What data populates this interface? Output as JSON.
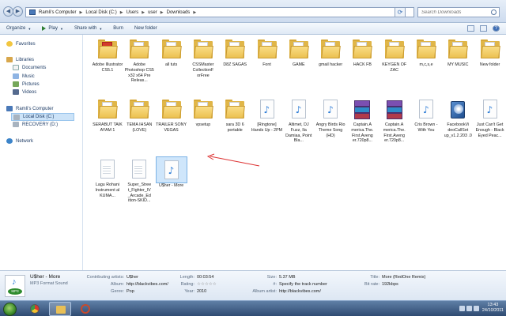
{
  "address": {
    "breadcrumbs": [
      "Ramli's Computer",
      "Local Disk (C:)",
      "Users",
      "user",
      "Downloads"
    ],
    "search_placeholder": "Search Downloads"
  },
  "toolbar": {
    "organize": "Organize",
    "play": "Play",
    "share": "Share with",
    "burn": "Burn",
    "new_folder": "New folder"
  },
  "sidebar": {
    "favorites": "Favorites",
    "libraries": "Libraries",
    "documents": "Documents",
    "music": "Music",
    "pictures": "Pictures",
    "videos": "Videos",
    "computer": "Ramli's Computer",
    "local_disk": "Local Disk (C:)",
    "recovery": "RECOVERY (D:)",
    "network": "Network"
  },
  "files": [
    {
      "label": "Adobe Illustrator CS5.1",
      "kind": "folder-red"
    },
    {
      "label": "Adobe Photoshop CS5 x32 x64 Pre Releas...",
      "kind": "folder"
    },
    {
      "label": "all tuts",
      "kind": "folder"
    },
    {
      "label": "CSSMaster CollectionF orFree",
      "kind": "folder"
    },
    {
      "label": "D8Z SAGAS",
      "kind": "folder"
    },
    {
      "label": "Font",
      "kind": "folder"
    },
    {
      "label": "GAME",
      "kind": "folder"
    },
    {
      "label": "gmail hacker",
      "kind": "folder"
    },
    {
      "label": "HACK FB",
      "kind": "folder"
    },
    {
      "label": "KEYGEN OF ZAC",
      "kind": "folder"
    },
    {
      "label": "m,c,s,e",
      "kind": "folder"
    },
    {
      "label": "MY MUSIC",
      "kind": "folder"
    },
    {
      "label": "New folder",
      "kind": "folder"
    },
    {
      "label": "SERABUT TAIK AYAM 1",
      "kind": "folder"
    },
    {
      "label": "TEMA IHSAN (LOVE)",
      "kind": "folder"
    },
    {
      "label": "TRAILER SONY VEGAS",
      "kind": "folder"
    },
    {
      "label": "vpsetup",
      "kind": "folder"
    },
    {
      "label": "sara 3D 6 portable",
      "kind": "folder"
    },
    {
      "label": "[Ringtone] Hands Up - 2PM",
      "kind": "audio"
    },
    {
      "label": "Altimet, DJ Fuzz, Ila Damiaa, Point Bla...",
      "kind": "audio"
    },
    {
      "label": "Angry Birds Rio Theme Song (HD)",
      "kind": "audio"
    },
    {
      "label": "Captain.A merica.The. First.Aveng er.720p8...",
      "kind": "rar"
    },
    {
      "label": "Captain.A merica.The. First.Aveng er.720p8...",
      "kind": "rar"
    },
    {
      "label": "Cris Brown - With You",
      "kind": "audio"
    },
    {
      "label": "FacebookVi deoCallSet up_v1.2.203 .0",
      "kind": "setup"
    },
    {
      "label": "Just Can't Get Enough - Black Eyed Peac...",
      "kind": "audio"
    },
    {
      "label": "Lagu Rohani Instrument al KUMA...",
      "kind": "doc"
    },
    {
      "label": "Super_Stree t_Fighter_IV _Arcade_Ed ition-SKID...",
      "kind": "doc"
    },
    {
      "label": "U$her - More",
      "kind": "audio",
      "selected": true
    }
  ],
  "details": {
    "name": "U$her - More",
    "type": "MP3 Format Sound",
    "type_badge": "MP3",
    "contributing_artists_label": "Contributing artists:",
    "contributing_artists": "U$her",
    "album_label": "Album:",
    "album": "http://blackvibes.com/",
    "genre_label": "Genre:",
    "genre": "Pop",
    "length_label": "Length:",
    "length": "00:03:54",
    "rating_label": "Rating:",
    "rating": "☆☆☆☆☆",
    "year_label": "Year:",
    "year": "2010",
    "size_label": "Size:",
    "size": "5.37 MB",
    "track_label": "#:",
    "track": "Specify the track number",
    "album_artist_label": "Album artist:",
    "album_artist": "http://blackvibes.com/",
    "title_label": "Title:",
    "title": "More (RedOne Remix)",
    "bitrate_label": "Bit rate:",
    "bitrate": "192kbps"
  },
  "taskbar": {
    "time": "13:43",
    "date": "24/10/2011"
  }
}
